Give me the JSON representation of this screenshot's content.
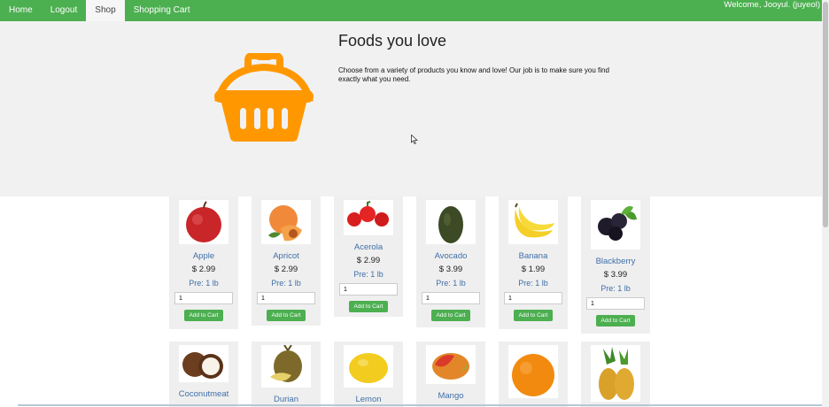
{
  "nav": {
    "links": [
      "Home",
      "Logout",
      "Shop",
      "Shopping Cart"
    ],
    "welcome": "Welcome, Jooyul. (juyeol)"
  },
  "hero": {
    "title": "Foods you love",
    "text": "Choose from a variety of products you know and love! Our job is to make sure you find exactly what you need."
  },
  "products": [
    {
      "name": "Apple",
      "price": "$ 2.99",
      "per": "Pre: 1 lb",
      "qty": "1",
      "button": "Add to Cart"
    },
    {
      "name": "Apricot",
      "price": "$ 2.99",
      "per": "Pre: 1 lb",
      "qty": "1",
      "button": "Add to Cart"
    },
    {
      "name": "Acerola",
      "price": "$ 2.99",
      "per": "Pre: 1 lb",
      "qty": "1",
      "button": "Add to Cart"
    },
    {
      "name": "Avocado",
      "price": "$ 3.99",
      "per": "Pre: 1 lb",
      "qty": "1",
      "button": "Add to Cart"
    },
    {
      "name": "Banana",
      "price": "$ 1.99",
      "per": "Pre: 1 lb",
      "qty": "1",
      "button": "Add to Cart"
    },
    {
      "name": "Blackberry",
      "price": "$ 3.99",
      "per": "Pre: 1 lb",
      "qty": "1",
      "button": "Add to Cart"
    }
  ],
  "products_row2": [
    {
      "name": "Coconutmeat"
    },
    {
      "name": "Durian"
    },
    {
      "name": "Lemon"
    },
    {
      "name": "Mango"
    },
    {
      "name": ""
    },
    {
      "name": ""
    }
  ],
  "colors": {
    "accent": "#4caf50",
    "basket": "#ff9800",
    "link": "#3f6fa8"
  }
}
